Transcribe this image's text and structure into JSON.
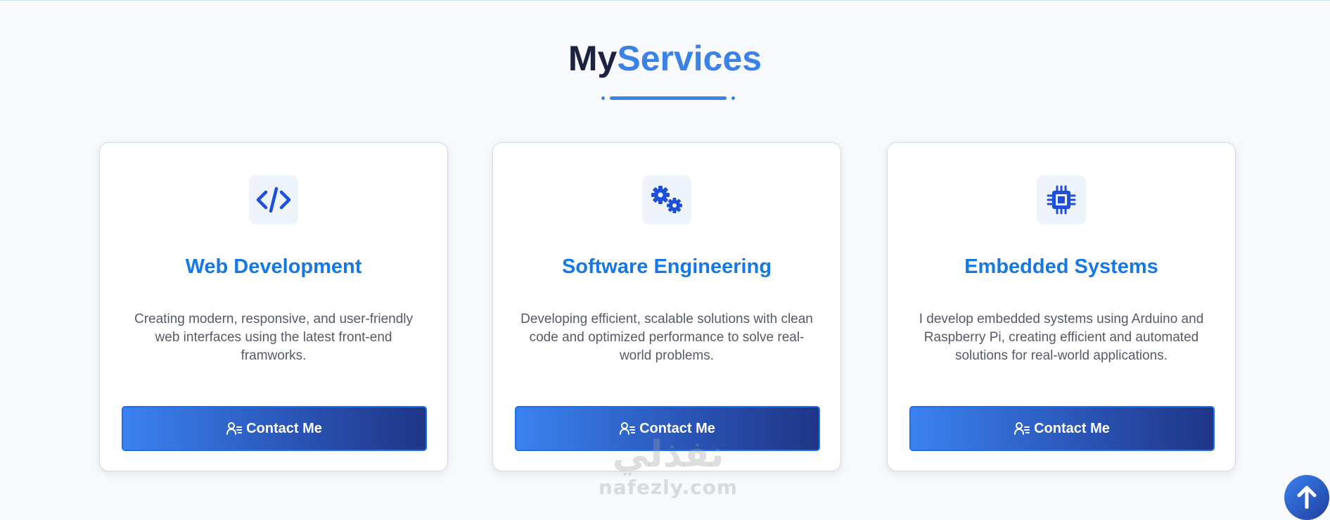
{
  "header": {
    "title_part1": "My",
    "title_part2": "Services"
  },
  "colors": {
    "accent": "#3b82e6",
    "title_dark": "#1b2340",
    "card_title": "#1479e6"
  },
  "services": [
    {
      "icon": "code-icon",
      "title": "Web Development",
      "description": "Creating modern, responsive, and user-friendly web interfaces using the latest front-end framworks.",
      "button_label": "Contact Me"
    },
    {
      "icon": "gears-icon",
      "title": "Software Engineering",
      "description": "Developing efficient, scalable solutions with clean code and optimized performance to solve real-world problems.",
      "button_label": "Contact Me"
    },
    {
      "icon": "microchip-icon",
      "title": "Embedded Systems",
      "description": "I develop embedded systems using Arduino and Raspberry Pi, creating efficient and automated solutions for real-world applications.",
      "button_label": "Contact Me"
    }
  ],
  "watermark": {
    "arabic": "نفذلي",
    "domain": "nafezly.com"
  },
  "scroll_top_icon": "arrow-up-icon"
}
